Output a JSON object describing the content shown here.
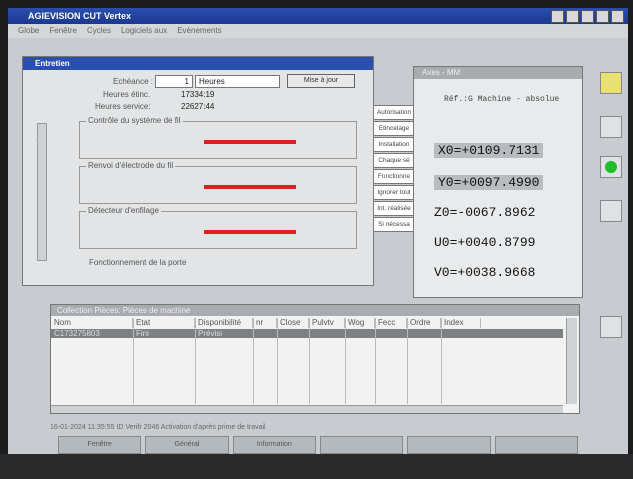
{
  "window": {
    "title": "AGIEVISION CUT Vertex"
  },
  "menu": [
    "Globe",
    "Fenêtre",
    "Cycles",
    "Logiciels aux",
    "Evènements"
  ],
  "entretien": {
    "title": "Entretien",
    "echeance_label": "Echéance :",
    "echeance_value": "1",
    "unit_value": "Heures",
    "update_button": "Mise à jour",
    "heures_label": "Heures étinc.",
    "heures_value": "17334:19",
    "service_label": "Heures service:",
    "service_value": "22627:44",
    "groups": [
      "Contrôle du système de fil",
      "Renvoi d'électrode du fil",
      "Détecteur d'enfilage"
    ],
    "footer_label": "Fonctionnement de la porte",
    "side_buttons": [
      "Autorisation",
      "Etincelage",
      "Installation",
      "Chaque sé",
      "Fonctionne",
      "Ignorer tout",
      "Int. réalisée",
      "Si nécessa"
    ]
  },
  "axes": {
    "title": "Axes - MM",
    "ref": "Réf.:G Machine - absolue",
    "coords": [
      "X0=+0109.7131",
      "Y0=+0097.4990",
      "Z0=-0067.8962",
      "U0=+0040.8799",
      "V0=+0038.9668"
    ]
  },
  "pieces": {
    "title": "Collection Pièces: Pièces de machine",
    "columns": [
      "Nom",
      "Etat",
      "Disponibilité",
      "nr",
      "Close",
      "Pulvtv",
      "Wog",
      "Fecc",
      "Ordre",
      "Index"
    ],
    "row": [
      "C173275803",
      "Fini",
      "Prévisi"
    ]
  },
  "status_text": "16-01-2024 11:35:55 ID Verifr 2046 Activation d'après prime de travail",
  "tabs": [
    "Fenêtre",
    "Général",
    "Information",
    "",
    "",
    ""
  ],
  "colors": {
    "titlebar": "#1b3890",
    "red_indicator": "#e02020"
  }
}
